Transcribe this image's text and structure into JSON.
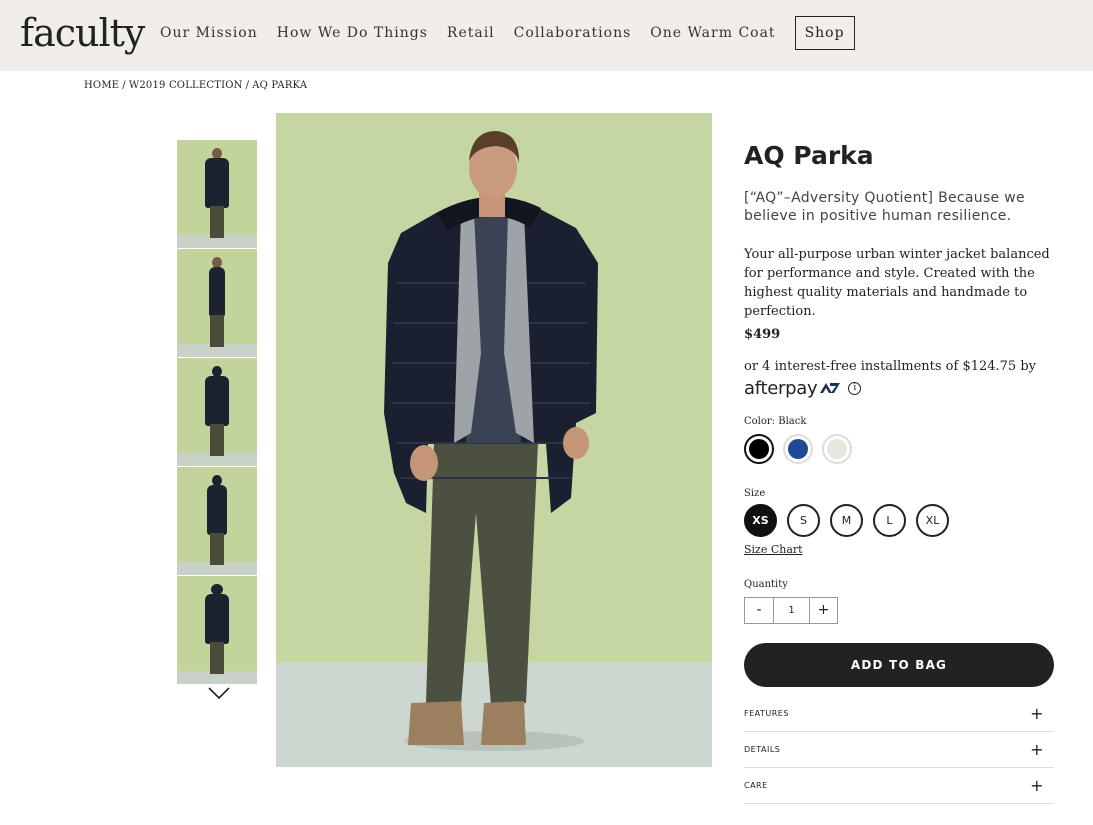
{
  "header": {
    "logo": "faculty",
    "nav": [
      "Our Mission",
      "How We Do Things",
      "Retail",
      "Collaborations",
      "One Warm Coat"
    ],
    "shop_label": "Shop"
  },
  "breadcrumb": [
    "HOME",
    "W2019 COLLECTION",
    "AQ PARKA"
  ],
  "product": {
    "title": "AQ Parka",
    "tagline": "[“AQ”–Adversity Quotient] Because we believe in positive human resilience.",
    "description": "Your all-purpose urban winter jacket balanced for performance and style. Created with the highest quality materials and handmade to perfection.",
    "price": "$499",
    "installments": "or 4 interest-free installments of $124.75 by",
    "afterpay_logo": "afterpay",
    "color_label": "Color: Black",
    "colors": [
      {
        "name": "Black",
        "hex": "#000000",
        "selected": true
      },
      {
        "name": "Blue",
        "hex": "#1c4a96",
        "selected": false
      },
      {
        "name": "Cream",
        "hex": "#e8e6df",
        "selected": false
      }
    ],
    "size_label": "Size",
    "sizes": [
      "XS",
      "S",
      "M",
      "L",
      "XL"
    ],
    "selected_size": "XS",
    "size_chart_label": "Size Chart",
    "quantity_label": "Quantity",
    "quantity": {
      "minus": "-",
      "value": "1",
      "plus": "+"
    },
    "add_to_bag": "ADD TO BAG",
    "accordion": [
      "FEATURES",
      "DETAILS",
      "CARE"
    ]
  },
  "colors": {
    "header_bg": "#f1eee9",
    "image_bg": "#c5d6a3",
    "button_dark": "#222222"
  }
}
